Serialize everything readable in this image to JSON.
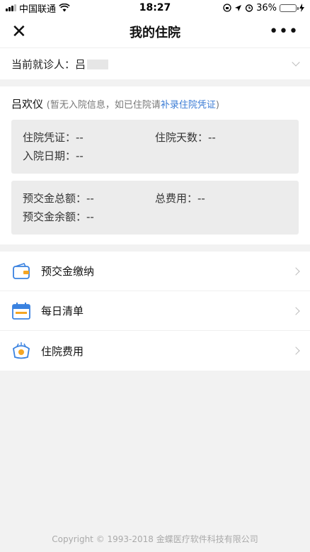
{
  "status_bar": {
    "carrier": "中国联通",
    "time": "18:27",
    "battery": "36%",
    "battery_level": 0.36
  },
  "nav": {
    "close_icon": "close-icon",
    "title": "我的住院",
    "more_icon": "more-icon"
  },
  "patient": {
    "label": "当前就诊人：吕"
  },
  "info": {
    "name": "吕欢仪",
    "hint_prefix": "(暂无入院信息，如已住院请",
    "hint_link": "补录住院凭证",
    "hint_suffix": ")",
    "admission": {
      "voucher": "住院凭证：--",
      "days": "住院天数：--",
      "date": "入院日期：--"
    },
    "fees": {
      "deposit_total": "预交金总额：--",
      "total_cost": "总费用：--",
      "deposit_balance": "预交金余额：--"
    }
  },
  "menu": {
    "items": [
      {
        "label": "预交金缴纳",
        "icon": "wallet-icon"
      },
      {
        "label": "每日清单",
        "icon": "calendar-icon"
      },
      {
        "label": "住院费用",
        "icon": "money-icon"
      }
    ]
  },
  "footer": {
    "copyright": "Copyright © 1993-2018 金蝶医疗软件科技有限公司"
  },
  "colors": {
    "accent": "#3a7bd5",
    "icon_blue": "#3a82e0",
    "battery_green": "#3ec43e"
  }
}
